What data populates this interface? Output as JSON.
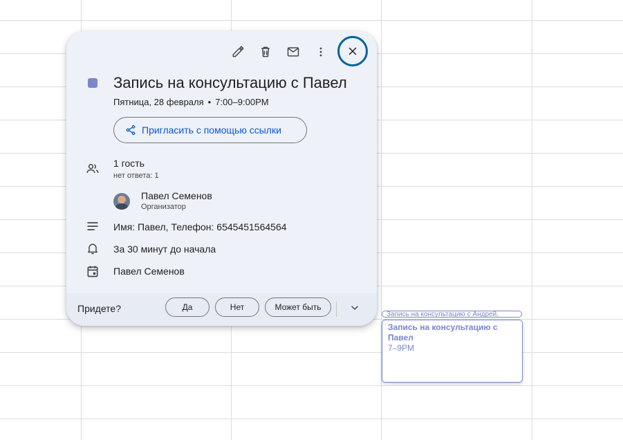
{
  "calendar": {
    "events": [
      {
        "title": "Запись на консультацию с Андрей,"
      },
      {
        "title": "Запись на консультацию с Павел",
        "time": "7–9PM"
      }
    ]
  },
  "popup": {
    "toolbar": {
      "icons": [
        "edit-icon",
        "delete-icon",
        "email-icon",
        "more-options-icon",
        "close-icon"
      ]
    },
    "event_color": "#7986cb",
    "title": "Запись на консультацию с Павел",
    "date": "Пятница, 28 февраля",
    "separator": "•",
    "time": "7:00–9:00PM",
    "invite_link_label": "Пригласить с помощью ссылки",
    "guests": {
      "count_label": "1 гость",
      "no_reply_label": "нет ответа: 1",
      "list": [
        {
          "name": "Павел Семенов",
          "role": "Организатор"
        }
      ]
    },
    "description": "Имя: Павел, Телефон: 6545451564564",
    "reminder": "За 30 минут до начала",
    "calendar_owner": "Павел Семенов",
    "rsvp": {
      "question": "Придете?",
      "yes": "Да",
      "no": "Нет",
      "maybe": "Может быть"
    }
  },
  "colors": {
    "accent_blue": "#0b57d0",
    "focus_ring": "#00639b",
    "event_lavender": "#7986cb"
  }
}
